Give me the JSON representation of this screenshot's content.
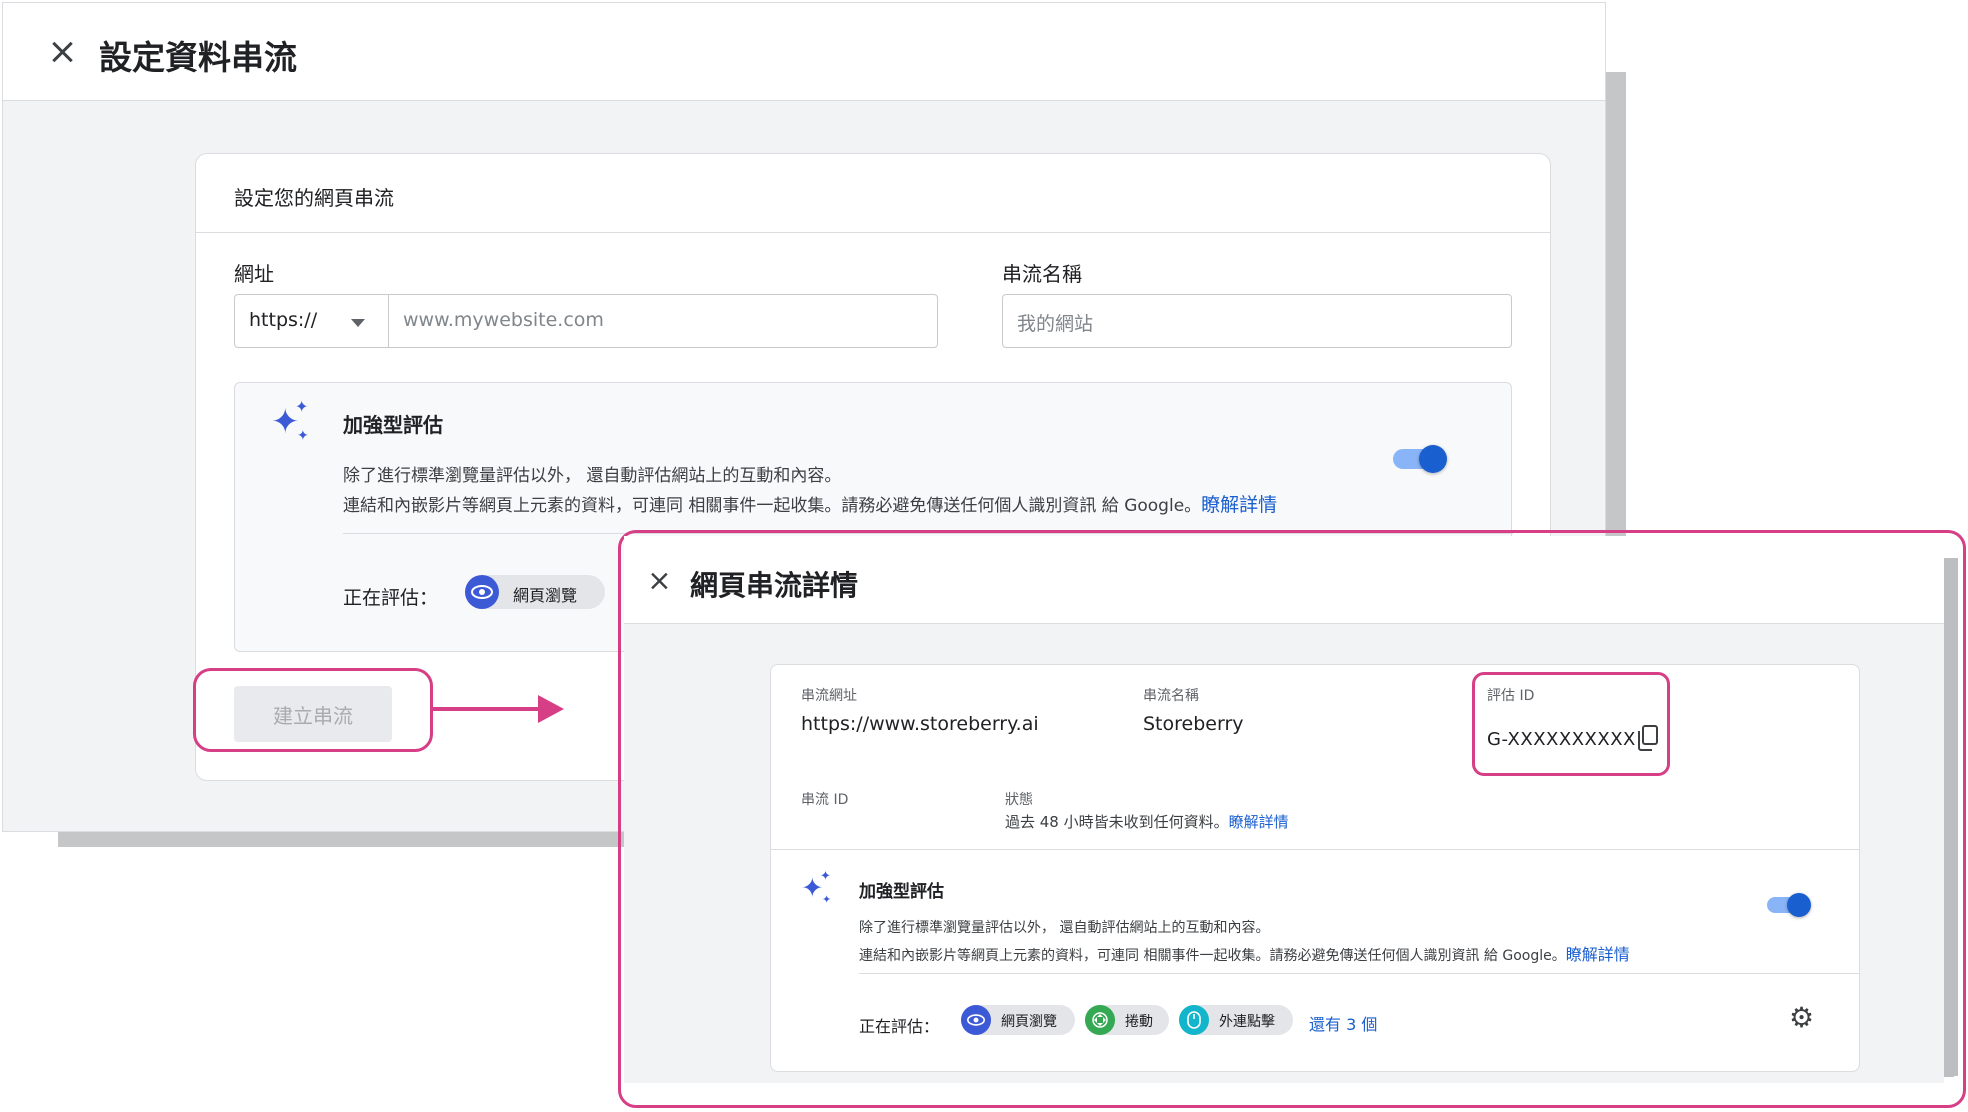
{
  "setup_panel": {
    "title": "設定資料串流",
    "card_heading": "設定您的網頁串流",
    "url_label": "網址",
    "protocol": "https://",
    "url_placeholder": "www.mywebsite.com",
    "stream_name_label": "串流名稱",
    "stream_name_placeholder": "我的網站",
    "enhanced": {
      "title": "加強型評估",
      "desc_line1": "除了進行標準瀏覽量評估以外， 還自動評估網站上的互動和內容。",
      "desc_line2": "連結和內嵌影片等網頁上元素的資料，可連同 相關事件一起收集。請務必避免傳送任何個人識別資訊 給 Google。",
      "learn_more": "瞭解詳情",
      "measuring_label": "正在評估：",
      "chips": [
        "網頁瀏覽"
      ],
      "toggle_on": true
    },
    "create_button": "建立串流"
  },
  "details_panel": {
    "title": "網頁串流詳情",
    "stream_url_label": "串流網址",
    "stream_url": "https://www.storeberry.ai",
    "stream_name_label": "串流名稱",
    "stream_name": "Storeberry",
    "measurement_id_label": "評估 ID",
    "measurement_id": "G-XXXXXXXXXX",
    "stream_id_label": "串流 ID",
    "status_label": "狀態",
    "status_text": "過去 48 小時皆未收到任何資料。",
    "status_link": "瞭解詳情",
    "enhanced": {
      "title": "加強型評估",
      "desc_line1": "除了進行標準瀏覽量評估以外， 還自動評估網站上的互動和內容。",
      "desc_line2": "連結和內嵌影片等網頁上元素的資料，可連同 相關事件一起收集。請務必避免傳送任何個人識別資訊 給 Google。",
      "learn_more": "瞭解詳情",
      "measuring_label": "正在評估：",
      "chips": [
        "網頁瀏覽",
        "捲動",
        "外連點擊"
      ],
      "more_link": "還有 3 個",
      "toggle_on": true
    }
  },
  "colors": {
    "accent_pink": "#d63f85",
    "link_blue": "#1a5fd0",
    "sparkle_blue": "#3c59d6",
    "scroll_green": "#34a853",
    "outbound_teal": "#12b5cb"
  }
}
